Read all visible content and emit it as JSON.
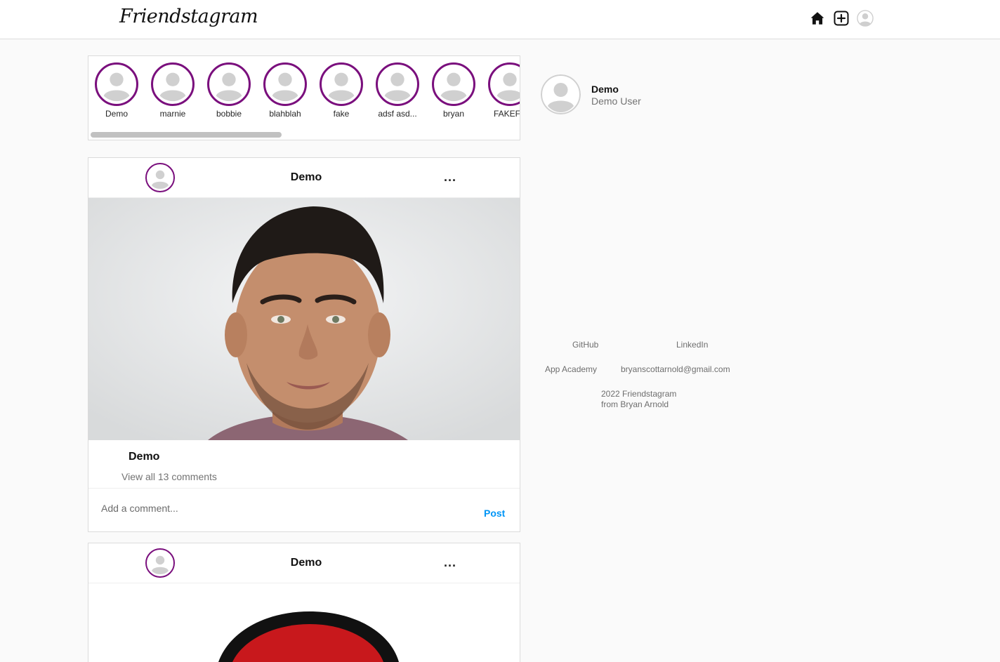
{
  "app": {
    "logo": "Friendstagram"
  },
  "nav": {
    "icons": [
      "home-icon",
      "new-post-icon",
      "profile-icon"
    ]
  },
  "stories": [
    {
      "name": "Demo"
    },
    {
      "name": "marnie"
    },
    {
      "name": "bobbie"
    },
    {
      "name": "blahblah"
    },
    {
      "name": "fake"
    },
    {
      "name": "adsf asd..."
    },
    {
      "name": "bryan"
    },
    {
      "name": "FAKEFK"
    }
  ],
  "colors": {
    "story_ring": "#7a0f7d",
    "post_button": "#0095f6"
  },
  "posts": [
    {
      "username": "Demo",
      "more": "...",
      "caption_user": "Demo",
      "view_comments": "View all 13 comments",
      "comment_placeholder": "Add a comment...",
      "post_label": "Post"
    },
    {
      "username": "Demo",
      "more": "..."
    }
  ],
  "sidebar": {
    "username": "Demo",
    "full_name": "Demo User",
    "footer": {
      "github": "GitHub",
      "linkedin": "LinkedIn",
      "app_academy": "App Academy",
      "email": "bryanscottarnold@gmail.com",
      "copyright_line1": "2022 Friendstagram",
      "copyright_line2": "from Bryan Arnold"
    }
  }
}
